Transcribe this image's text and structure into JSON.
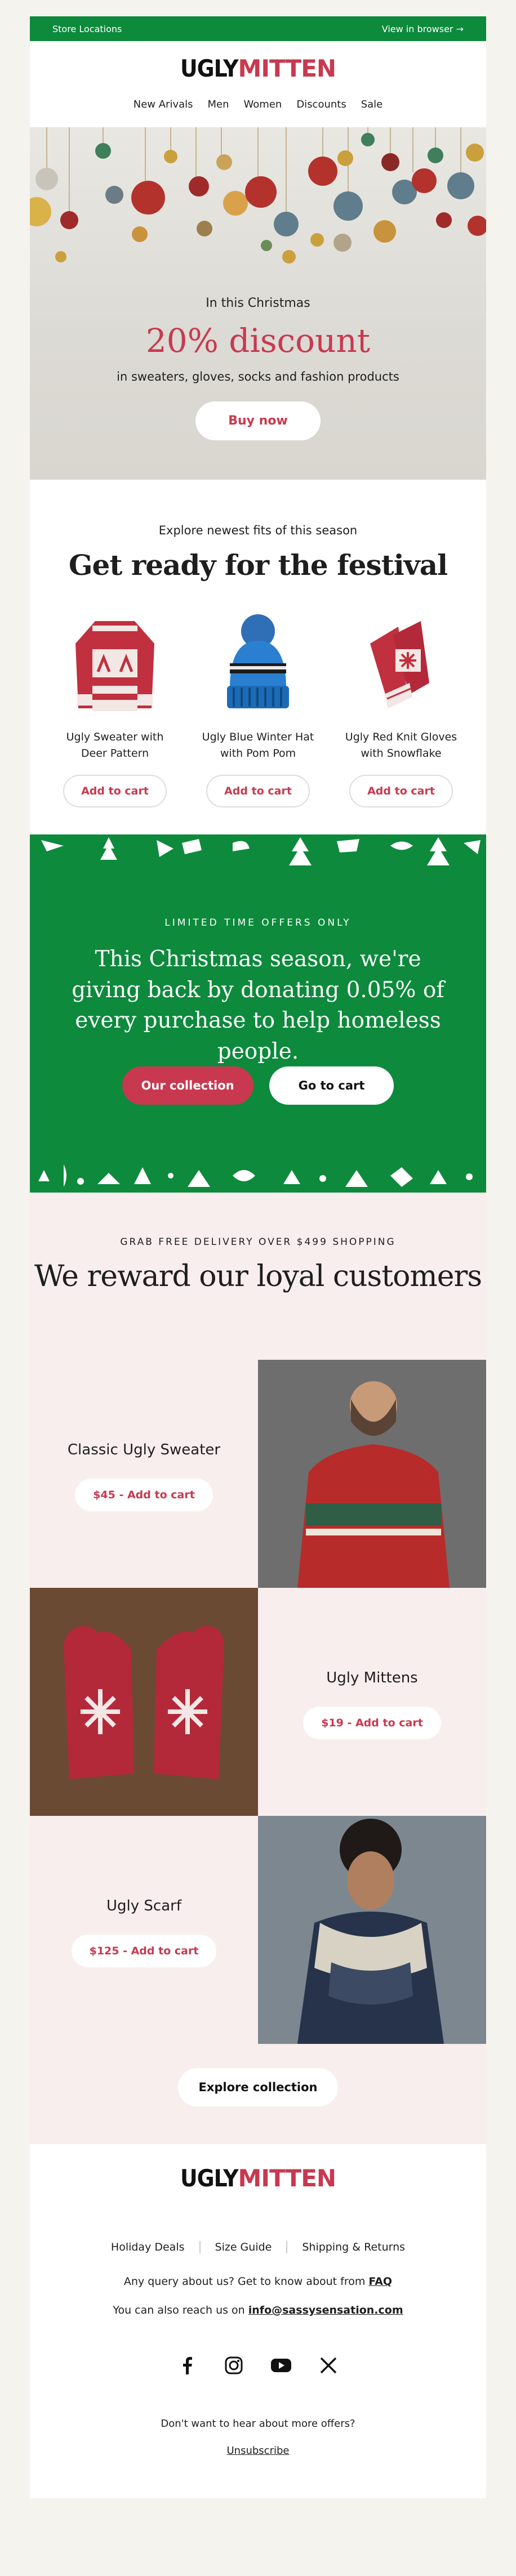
{
  "topbar": {
    "left": "Store Locations",
    "right": "View in browser →"
  },
  "brand": {
    "part1": "UGLY",
    "part2": "MITTEN",
    "accent": "#c8394f",
    "green": "#0d8a3c"
  },
  "nav": [
    "New Arivals",
    "Men",
    "Women",
    "Discounts",
    "Sale"
  ],
  "hero": {
    "intro": "In this Christmas",
    "headline": "20% discount",
    "subtitle": "in sweaters, gloves, socks and fashion products",
    "cta": "Buy now"
  },
  "festival": {
    "kicker": "Explore newest fits of this season",
    "title": "Get ready for the festival",
    "products": [
      {
        "name": "Ugly Sweater with Deer Pattern",
        "cta": "Add to cart",
        "icon": "sweater-icon"
      },
      {
        "name": "Ugly Blue Winter Hat with Pom Pom",
        "cta": "Add to cart",
        "icon": "beanie-icon"
      },
      {
        "name": "Ugly Red Knit Gloves with Snowflake",
        "cta": "Add to cart",
        "icon": "gloves-icon"
      }
    ]
  },
  "donation": {
    "kicker": "LIMITED TIME OFFERS ONLY",
    "message": "This Christmas season, we're giving back by donating 0.05% of every purchase to help homeless people.",
    "cta_primary": "Our collection",
    "cta_secondary": "Go to cart"
  },
  "loyal": {
    "kicker": "GRAB FREE DELIVERY OVER $499 SHOPPING",
    "title": "We reward our loyal customers",
    "items": [
      {
        "name": "Classic Ugly Sweater",
        "cta": "$45 - Add to cart"
      },
      {
        "name": "Ugly Mittens",
        "cta": "$19 - Add to cart"
      },
      {
        "name": "Ugly Scarf",
        "cta": "$125 - Add to cart"
      }
    ],
    "explore": "Explore collection"
  },
  "footer": {
    "links": [
      "Holiday Deals",
      "Size Guide",
      "Shipping & Returns"
    ],
    "query_text": "Any query about us? Get to know about from ",
    "query_link": "FAQ",
    "reach_text": "You can also reach us on ",
    "reach_email": "info@sassysensation.com",
    "socials": [
      "facebook-icon",
      "instagram-icon",
      "youtube-icon",
      "x-icon"
    ],
    "offers_text": "Don't want to hear about more offers?",
    "unsubscribe": "Unsubscribe"
  }
}
